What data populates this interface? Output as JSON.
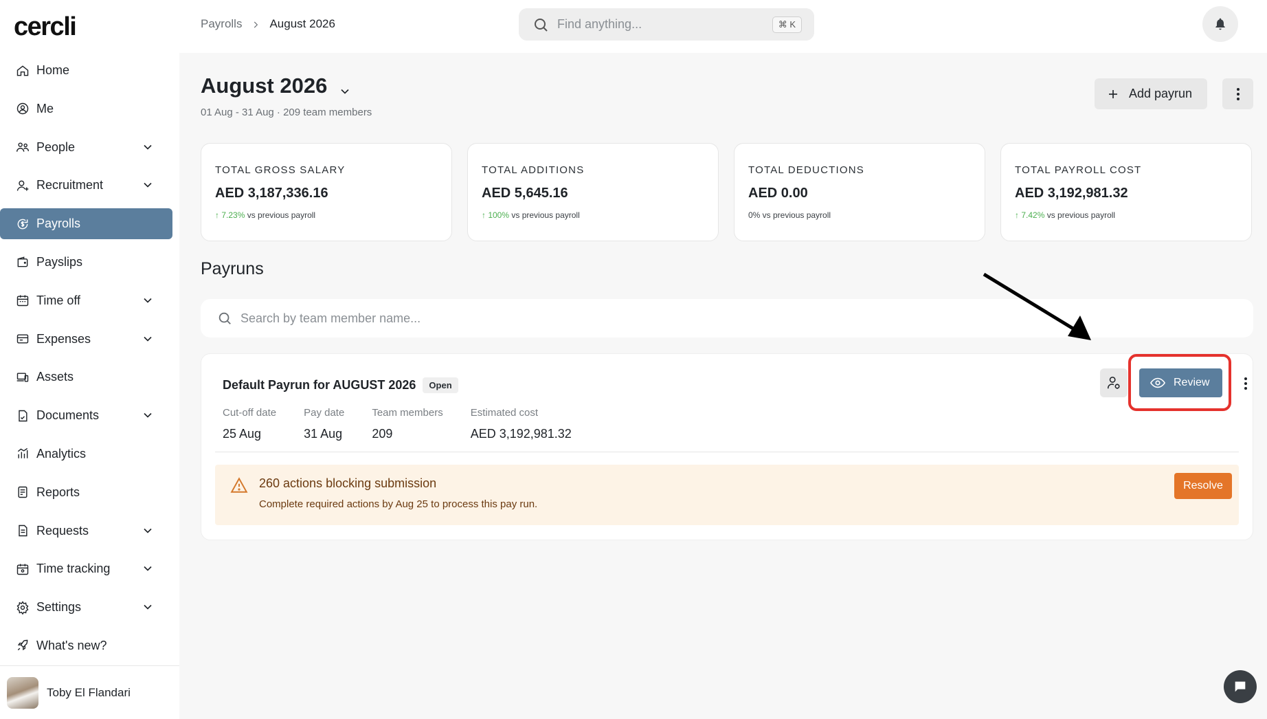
{
  "app": {
    "logo": "cercli"
  },
  "sidebar": {
    "items": [
      {
        "label": "Home",
        "icon": "home-icon",
        "expandable": false,
        "active": false
      },
      {
        "label": "Me",
        "icon": "user-circle-icon",
        "expandable": false,
        "active": false
      },
      {
        "label": "People",
        "icon": "people-icon",
        "expandable": true,
        "active": false
      },
      {
        "label": "Recruitment",
        "icon": "user-plus-icon",
        "expandable": true,
        "active": false
      },
      {
        "label": "Payrolls",
        "icon": "payroll-icon",
        "expandable": false,
        "active": true
      },
      {
        "label": "Payslips",
        "icon": "wallet-icon",
        "expandable": false,
        "active": false
      },
      {
        "label": "Time off",
        "icon": "calendar-icon",
        "expandable": true,
        "active": false
      },
      {
        "label": "Expenses",
        "icon": "receipt-icon",
        "expandable": true,
        "active": false
      },
      {
        "label": "Assets",
        "icon": "devices-icon",
        "expandable": false,
        "active": false
      },
      {
        "label": "Documents",
        "icon": "document-icon",
        "expandable": true,
        "active": false
      },
      {
        "label": "Analytics",
        "icon": "analytics-icon",
        "expandable": false,
        "active": false
      },
      {
        "label": "Reports",
        "icon": "report-icon",
        "expandable": false,
        "active": false
      },
      {
        "label": "Requests",
        "icon": "requests-icon",
        "expandable": true,
        "active": false
      },
      {
        "label": "Time tracking",
        "icon": "clock-calendar-icon",
        "expandable": true,
        "active": false
      },
      {
        "label": "Settings",
        "icon": "gear-icon",
        "expandable": true,
        "active": false
      },
      {
        "label": "What's new?",
        "icon": "rocket-icon",
        "expandable": false,
        "active": false
      }
    ],
    "user": {
      "name": "Toby El Flandari"
    }
  },
  "topbar": {
    "breadcrumb": [
      "Payrolls",
      "August 2026"
    ],
    "search_placeholder": "Find anything...",
    "shortcut": "⌘ K"
  },
  "page": {
    "title": "August 2026",
    "subtitle": "01 Aug - 31 Aug · 209 team members",
    "add_payrun_label": "Add payrun"
  },
  "cards": [
    {
      "label": "TOTAL GROSS SALARY",
      "value": "AED 3,187,336.16",
      "trend_value": "↑ 7.23%",
      "trend_text": " vs previous payroll",
      "trend_up": true
    },
    {
      "label": "TOTAL ADDITIONS",
      "value": "AED 5,645.16",
      "trend_value": "↑ 100%",
      "trend_text": " vs previous payroll",
      "trend_up": true
    },
    {
      "label": "TOTAL DEDUCTIONS",
      "value": "AED 0.00",
      "trend_value": "0%",
      "trend_text": " vs previous payroll",
      "trend_up": false
    },
    {
      "label": "TOTAL PAYROLL COST",
      "value": "AED 3,192,981.32",
      "trend_value": "↑ 7.42%",
      "trend_text": " vs previous payroll",
      "trend_up": true
    }
  ],
  "payruns": {
    "section_title": "Payruns",
    "search_placeholder": "Search by team member name...",
    "items": [
      {
        "title": "Default Payrun for AUGUST 2026",
        "status": "Open",
        "review_label": "Review",
        "meta": [
          {
            "label": "Cut-off date",
            "value": "25 Aug"
          },
          {
            "label": "Pay date",
            "value": "31 Aug"
          },
          {
            "label": "Team members",
            "value": "209"
          },
          {
            "label": "Estimated cost",
            "value": "AED 3,192,981.32"
          }
        ],
        "alert": {
          "title": "260 actions blocking submission",
          "text": "Complete required actions by Aug 25 to process this pay run.",
          "action_label": "Resolve"
        }
      }
    ]
  },
  "colors": {
    "accent": "#5b7e9d",
    "warning": "#e47528",
    "positive": "#4caf50",
    "highlight": "#e5322d"
  }
}
